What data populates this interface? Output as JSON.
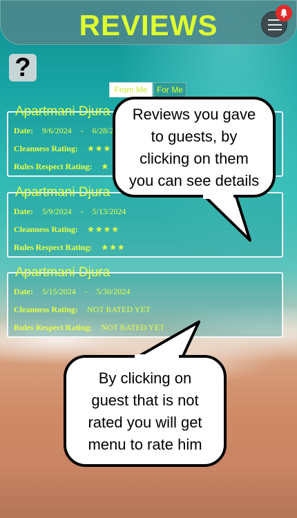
{
  "header": {
    "title": "REVIEWS",
    "notification_icon": "bell-icon",
    "menu_icon": "hamburger-icon"
  },
  "help": {
    "symbol": "?"
  },
  "tabs": [
    {
      "label": "From Me",
      "active": true
    },
    {
      "label": "For Me",
      "active": false
    }
  ],
  "reviews": [
    {
      "name": "Apartmani Djura",
      "date_label": "Date:",
      "date_from": "9/6/2024",
      "date_sep": "-",
      "date_to": "6/28/2",
      "cleanness_label": "Cleanness Rating:",
      "cleanness_value": "★★★",
      "rules_label": "Rules Respect Rating:",
      "rules_value": "★"
    },
    {
      "name": "Apartmani Djura",
      "date_label": "Date:",
      "date_from": "5/9/2024",
      "date_sep": "-",
      "date_to": "5/13/2024",
      "cleanness_label": "Cleanness Rating:",
      "cleanness_value": "★★★★",
      "rules_label": "Rules Respect Rating:",
      "rules_value": "★★★"
    },
    {
      "name": "Apartmani Djura",
      "date_label": "Date:",
      "date_from": "5/15/2024",
      "date_sep": "-",
      "date_to": "5/30/2024",
      "cleanness_label": "Cleanness Rating:",
      "cleanness_value": "NOT RATED YET",
      "rules_label": "Rules Respect Rating:",
      "rules_value": "NOT RATED YET"
    }
  ],
  "tooltips": {
    "top": [
      "Reviews you gave",
      "to guests, by",
      "clicking on them",
      "you can see details"
    ],
    "bottom": [
      "By clicking on",
      "guest that is not",
      "rated you will get",
      "menu to rate him"
    ]
  },
  "colors": {
    "accent": "#dfff2f",
    "header_bg": "#50878c",
    "notification": "#e22a2a"
  }
}
